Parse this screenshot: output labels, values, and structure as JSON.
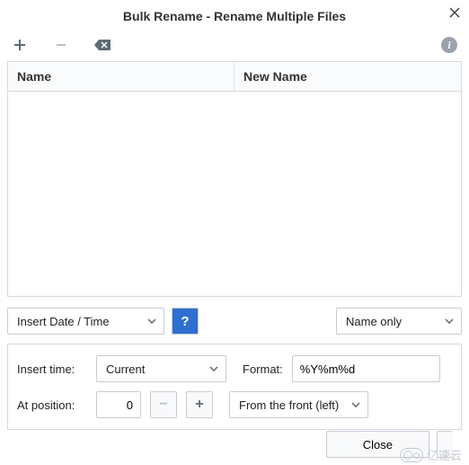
{
  "window": {
    "title": "Bulk Rename - Rename Multiple Files"
  },
  "table": {
    "col1": "Name",
    "col2": "New Name"
  },
  "mode_select": {
    "value": "Insert Date / Time"
  },
  "scope_select": {
    "value": "Name only"
  },
  "options": {
    "insert_time_label": "Insert time:",
    "insert_time_value": "Current",
    "format_label": "Format:",
    "format_value": "%Y%m%d",
    "position_label": "At position:",
    "position_value": "0",
    "direction_value": "From the front (left)"
  },
  "footer": {
    "close": "Close"
  },
  "watermark": "亿速云"
}
